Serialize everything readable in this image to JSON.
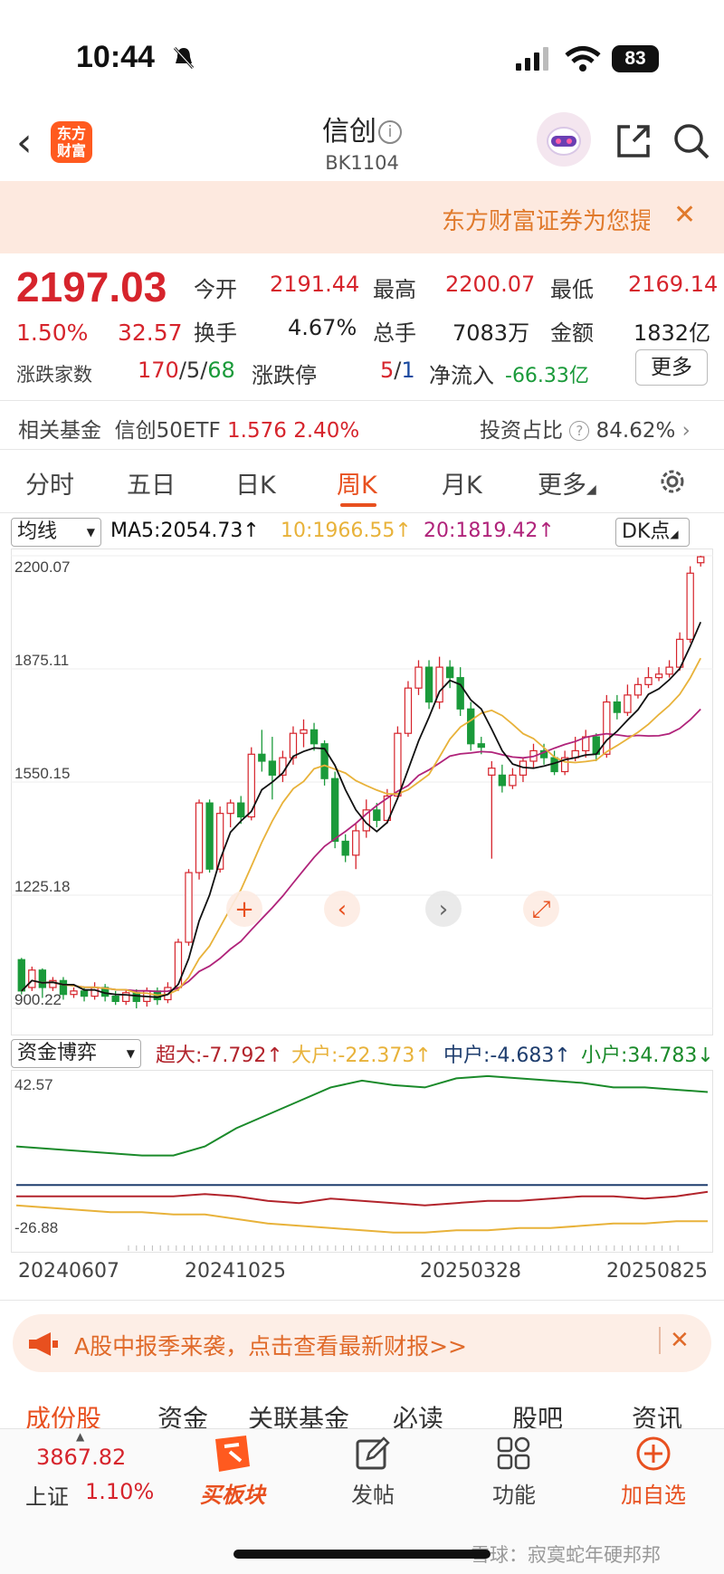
{
  "status_bar": {
    "time": "10:44",
    "battery": "83"
  },
  "header": {
    "logo_text": "东方财富",
    "title": "信创",
    "code": "BK1104"
  },
  "banner": {
    "text": "东方财富证券为您提"
  },
  "quote": {
    "price": "2197.03",
    "change_pct": "1.50%",
    "change": "32.57",
    "open_label": "今开",
    "open": "2191.44",
    "high_label": "最高",
    "high": "2200.07",
    "low_label": "最低",
    "low": "2169.14",
    "turnover_label": "换手",
    "turnover": "4.67%",
    "volume_label": "总手",
    "volume": "7083万",
    "amount_label": "金额",
    "amount": "1832亿",
    "updown_label": "涨跌家数",
    "up": "170",
    "flat": "5",
    "down": "68",
    "limit_label": "涨跌停",
    "limit_up": "5",
    "limit_down": "1",
    "netflow_label": "净流入",
    "netflow": "-66.33亿",
    "more": "更多"
  },
  "fund": {
    "label": "相关基金",
    "name": "信创50ETF",
    "price": "1.576",
    "pct": "2.40%",
    "ratio_label": "投资占比",
    "ratio": "84.62%"
  },
  "tabs": [
    "分时",
    "五日",
    "日K",
    "周K",
    "月K",
    "更多"
  ],
  "active_tab": "周K",
  "ma_bar": {
    "select": "均线",
    "ma5": "MA5:2054.73↑",
    "ma10": "10:1966.55↑",
    "ma20": "20:1819.42↑",
    "dk": "DK点"
  },
  "colors": {
    "up": "#d6242c",
    "down": "#1a9a3a",
    "ma5": "#111111",
    "ma10": "#e8b23a",
    "ma20": "#b0237a",
    "accent": "#e8501f"
  },
  "capflow_bar": {
    "select": "资金博弈",
    "super": "超大:-7.792↑",
    "big": "大户:-22.373↑",
    "mid": "中户:-4.683↑",
    "small": "小户:34.783↓"
  },
  "chart_data": [
    {
      "type": "candlestick",
      "title": "",
      "y_ticks": [
        "2200.07",
        "1875.11",
        "1550.15",
        "1225.18",
        "900.22"
      ],
      "ylim": [
        900.22,
        2200.07
      ],
      "x_ticks": [
        "20240607",
        "20241025",
        "20250328",
        "20250825"
      ],
      "candles": [
        {
          "o": 1040,
          "c": 950,
          "h": 1045,
          "l": 940
        },
        {
          "o": 960,
          "c": 1010,
          "h": 1020,
          "l": 950
        },
        {
          "o": 1010,
          "c": 960,
          "h": 1015,
          "l": 930
        },
        {
          "o": 960,
          "c": 980,
          "h": 990,
          "l": 950
        },
        {
          "o": 980,
          "c": 940,
          "h": 990,
          "l": 925
        },
        {
          "o": 940,
          "c": 950,
          "h": 960,
          "l": 930
        },
        {
          "o": 950,
          "c": 935,
          "h": 960,
          "l": 920
        },
        {
          "o": 935,
          "c": 960,
          "h": 975,
          "l": 925
        },
        {
          "o": 960,
          "c": 935,
          "h": 970,
          "l": 920
        },
        {
          "o": 935,
          "c": 920,
          "h": 950,
          "l": 910
        },
        {
          "o": 920,
          "c": 945,
          "h": 955,
          "l": 910
        },
        {
          "o": 945,
          "c": 920,
          "h": 955,
          "l": 900
        },
        {
          "o": 920,
          "c": 950,
          "h": 960,
          "l": 905
        },
        {
          "o": 950,
          "c": 925,
          "h": 960,
          "l": 910
        },
        {
          "o": 925,
          "c": 960,
          "h": 975,
          "l": 915
        },
        {
          "o": 960,
          "c": 1090,
          "h": 1100,
          "l": 950
        },
        {
          "o": 1090,
          "c": 1290,
          "h": 1300,
          "l": 1080
        },
        {
          "o": 1290,
          "c": 1490,
          "h": 1500,
          "l": 1270
        },
        {
          "o": 1490,
          "c": 1300,
          "h": 1500,
          "l": 1290
        },
        {
          "o": 1300,
          "c": 1460,
          "h": 1480,
          "l": 1290
        },
        {
          "o": 1460,
          "c": 1490,
          "h": 1500,
          "l": 1420
        },
        {
          "o": 1490,
          "c": 1450,
          "h": 1510,
          "l": 1430
        },
        {
          "o": 1450,
          "c": 1630,
          "h": 1650,
          "l": 1440
        },
        {
          "o": 1630,
          "c": 1610,
          "h": 1700,
          "l": 1580
        },
        {
          "o": 1610,
          "c": 1570,
          "h": 1680,
          "l": 1500
        },
        {
          "o": 1570,
          "c": 1620,
          "h": 1640,
          "l": 1550
        },
        {
          "o": 1620,
          "c": 1690,
          "h": 1710,
          "l": 1600
        },
        {
          "o": 1690,
          "c": 1700,
          "h": 1730,
          "l": 1650
        },
        {
          "o": 1700,
          "c": 1660,
          "h": 1720,
          "l": 1640
        },
        {
          "o": 1660,
          "c": 1560,
          "h": 1670,
          "l": 1540
        },
        {
          "o": 1560,
          "c": 1380,
          "h": 1580,
          "l": 1360
        },
        {
          "o": 1380,
          "c": 1340,
          "h": 1400,
          "l": 1320
        },
        {
          "o": 1340,
          "c": 1410,
          "h": 1430,
          "l": 1300
        },
        {
          "o": 1410,
          "c": 1470,
          "h": 1500,
          "l": 1390
        },
        {
          "o": 1470,
          "c": 1440,
          "h": 1490,
          "l": 1420
        },
        {
          "o": 1440,
          "c": 1510,
          "h": 1530,
          "l": 1430
        },
        {
          "o": 1510,
          "c": 1690,
          "h": 1710,
          "l": 1500
        },
        {
          "o": 1690,
          "c": 1820,
          "h": 1840,
          "l": 1680
        },
        {
          "o": 1820,
          "c": 1880,
          "h": 1900,
          "l": 1800
        },
        {
          "o": 1880,
          "c": 1780,
          "h": 1900,
          "l": 1760
        },
        {
          "o": 1780,
          "c": 1880,
          "h": 1910,
          "l": 1760
        },
        {
          "o": 1880,
          "c": 1850,
          "h": 1900,
          "l": 1820
        },
        {
          "o": 1850,
          "c": 1760,
          "h": 1880,
          "l": 1740
        },
        {
          "o": 1760,
          "c": 1660,
          "h": 1780,
          "l": 1640
        },
        {
          "o": 1660,
          "c": 1650,
          "h": 1680,
          "l": 1630
        },
        {
          "o": 1570,
          "c": 1590,
          "h": 1610,
          "l": 1330
        },
        {
          "o": 1570,
          "c": 1540,
          "h": 1600,
          "l": 1520
        },
        {
          "o": 1540,
          "c": 1570,
          "h": 1590,
          "l": 1530
        },
        {
          "o": 1570,
          "c": 1610,
          "h": 1620,
          "l": 1550
        },
        {
          "o": 1610,
          "c": 1640,
          "h": 1660,
          "l": 1590
        },
        {
          "o": 1640,
          "c": 1620,
          "h": 1660,
          "l": 1600
        },
        {
          "o": 1620,
          "c": 1580,
          "h": 1640,
          "l": 1570
        },
        {
          "o": 1580,
          "c": 1620,
          "h": 1640,
          "l": 1570
        },
        {
          "o": 1620,
          "c": 1640,
          "h": 1680,
          "l": 1610
        },
        {
          "o": 1640,
          "c": 1680,
          "h": 1700,
          "l": 1620
        },
        {
          "o": 1680,
          "c": 1630,
          "h": 1690,
          "l": 1610
        },
        {
          "o": 1630,
          "c": 1780,
          "h": 1800,
          "l": 1620
        },
        {
          "o": 1780,
          "c": 1750,
          "h": 1800,
          "l": 1730
        },
        {
          "o": 1750,
          "c": 1800,
          "h": 1830,
          "l": 1740
        },
        {
          "o": 1800,
          "c": 1830,
          "h": 1850,
          "l": 1790
        },
        {
          "o": 1830,
          "c": 1850,
          "h": 1880,
          "l": 1820
        },
        {
          "o": 1850,
          "c": 1860,
          "h": 1880,
          "l": 1840
        },
        {
          "o": 1860,
          "c": 1880,
          "h": 1900,
          "l": 1850
        },
        {
          "o": 1880,
          "c": 1960,
          "h": 1980,
          "l": 1870
        },
        {
          "o": 1960,
          "c": 2150,
          "h": 2170,
          "l": 1950
        },
        {
          "o": 2180,
          "c": 2197,
          "h": 2200,
          "l": 2169
        }
      ],
      "ma5_last": 2054.73,
      "ma10_last": 1966.55,
      "ma20_last": 1819.42
    },
    {
      "type": "line",
      "title": "",
      "y_ticks": [
        "42.57",
        "-26.88"
      ],
      "ylim": [
        -26.88,
        42.57
      ],
      "series": [
        {
          "name": "小户",
          "color": "#1a8a2a",
          "values": [
            12,
            11,
            10,
            9,
            8,
            8,
            12,
            20,
            26,
            32,
            38,
            41,
            39,
            38,
            42,
            43,
            42,
            41,
            40,
            38,
            38,
            37,
            36
          ]
        },
        {
          "name": "中户",
          "color": "#1e3d6e",
          "values": [
            -5,
            -5,
            -5,
            -5,
            -5,
            -5,
            -5,
            -5,
            -5,
            -5,
            -5,
            -5,
            -5,
            -5,
            -5,
            -5,
            -5,
            -5,
            -5,
            -5,
            -5,
            -5,
            -5
          ]
        },
        {
          "name": "超大",
          "color": "#b2242c",
          "values": [
            -10,
            -10,
            -10,
            -10,
            -10,
            -10,
            -9,
            -10,
            -12,
            -13,
            -11,
            -12,
            -13,
            -14,
            -13,
            -12,
            -12,
            -11,
            -10,
            -10,
            -11,
            -10,
            -8
          ]
        },
        {
          "name": "大户",
          "color": "#e8b23a",
          "values": [
            -14,
            -15,
            -16,
            -17,
            -17,
            -18,
            -18,
            -20,
            -22,
            -23,
            -24,
            -25,
            -26,
            -26,
            -25,
            -25,
            -24,
            -24,
            -23,
            -22,
            -22,
            -21,
            -21
          ]
        }
      ]
    }
  ],
  "ad": {
    "text": "A股中报季来袭，点击查看最新财报>>"
  },
  "sub_tabs": [
    "成份股",
    "资金",
    "关联基金",
    "必读",
    "股吧",
    "资讯"
  ],
  "bottom_nav": {
    "index_value": "3867.82",
    "index_name": "上证",
    "index_pct": "1.10%",
    "buy": "买板块",
    "post": "发帖",
    "func": "功能",
    "add": "加自选"
  },
  "watermark": "雪球：寂寞蛇年硬邦邦"
}
